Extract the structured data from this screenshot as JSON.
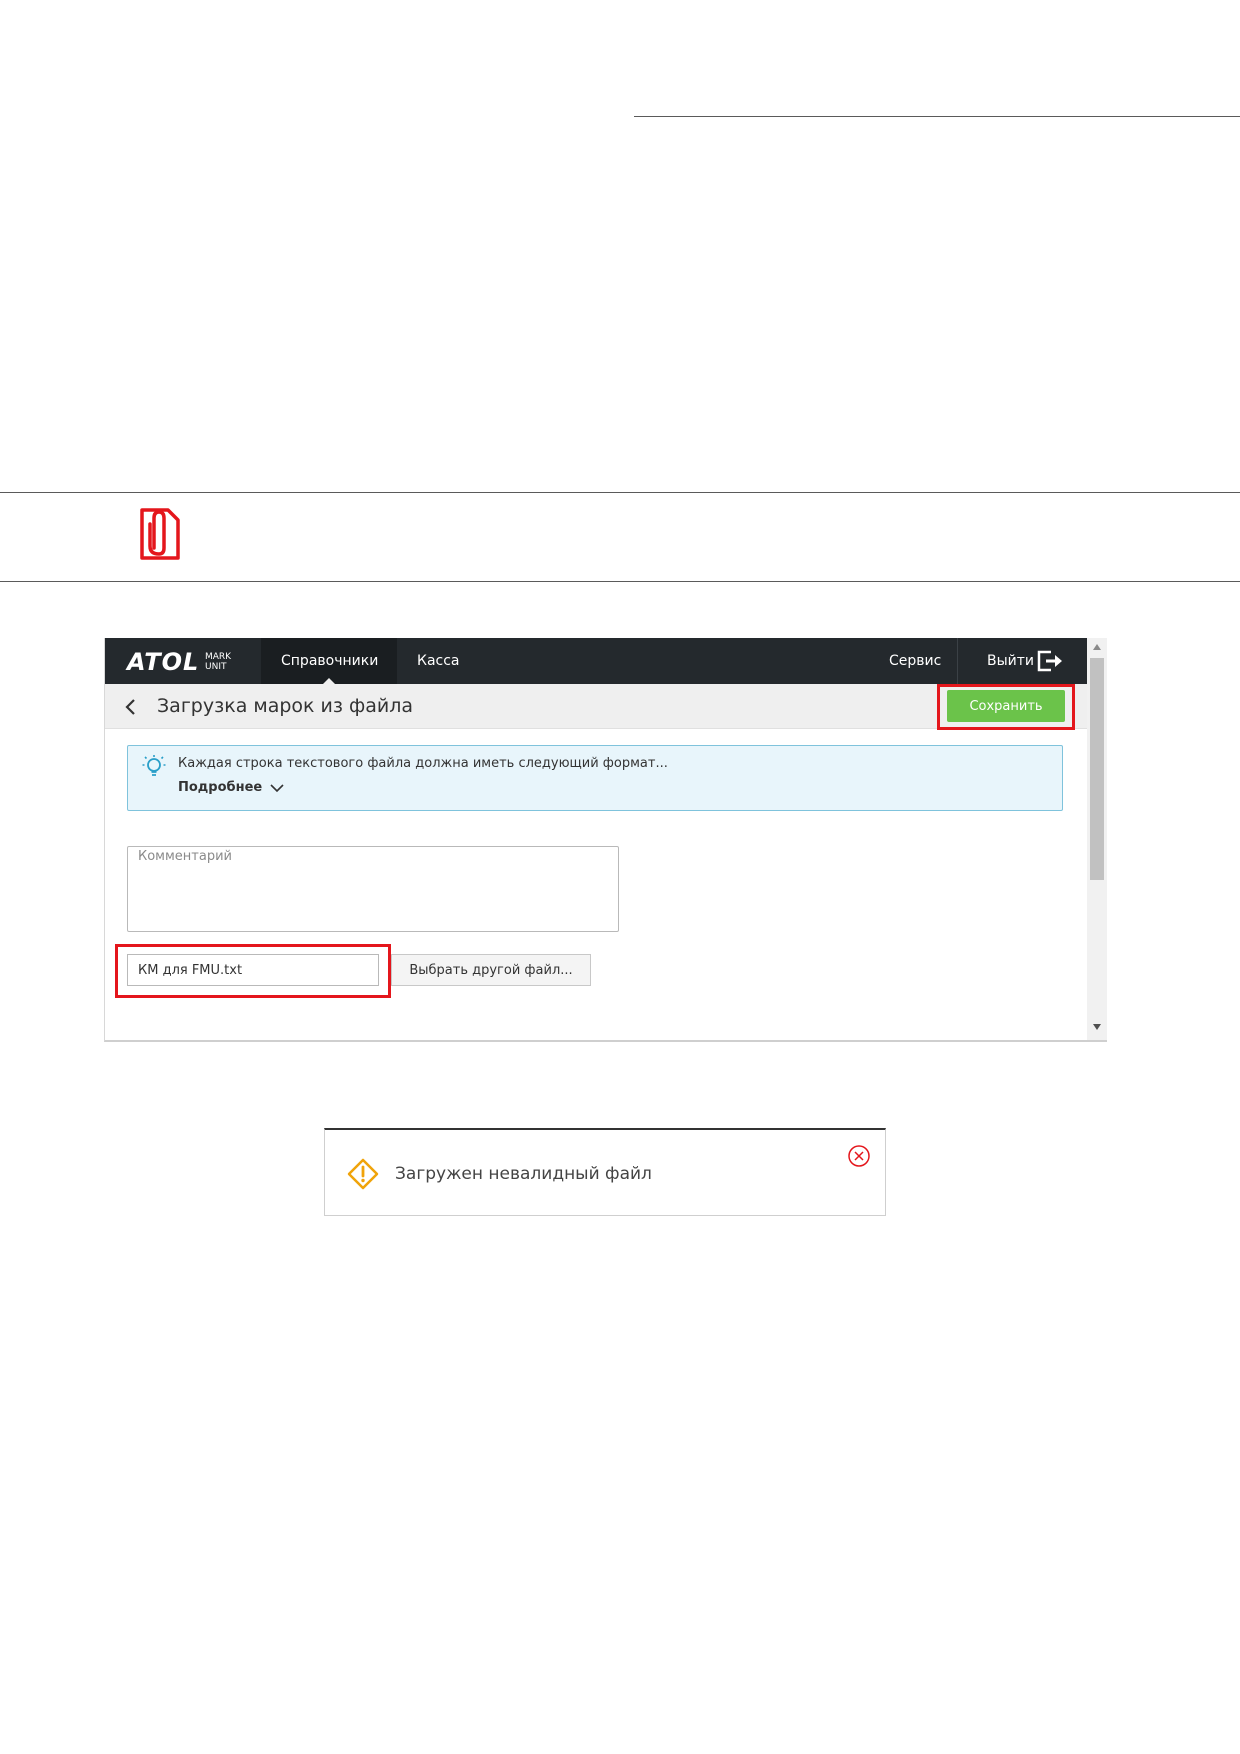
{
  "app": {
    "logo": "ATOL",
    "logo_sub_1": "MARK",
    "logo_sub_2": "UNIT",
    "nav": [
      "Справочники",
      "Касса"
    ],
    "service": "Сервис",
    "logout": "Выйти"
  },
  "page": {
    "title": "Загрузка марок из файла",
    "save_label": "Сохранить"
  },
  "info": {
    "text": "Каждая строка текстового файла должна иметь следующий формат...",
    "more": "Подробнее"
  },
  "form": {
    "comment_placeholder": "Комментарий",
    "file_value": "КМ для FMU.txt",
    "pick_label": "Выбрать другой файл..."
  },
  "toast": {
    "text": "Загружен невалидный файл"
  },
  "colors": {
    "highlight": "#e4161c",
    "save": "#6bc34a",
    "warning": "#f0a30a",
    "note_icon": "#e4161c"
  }
}
